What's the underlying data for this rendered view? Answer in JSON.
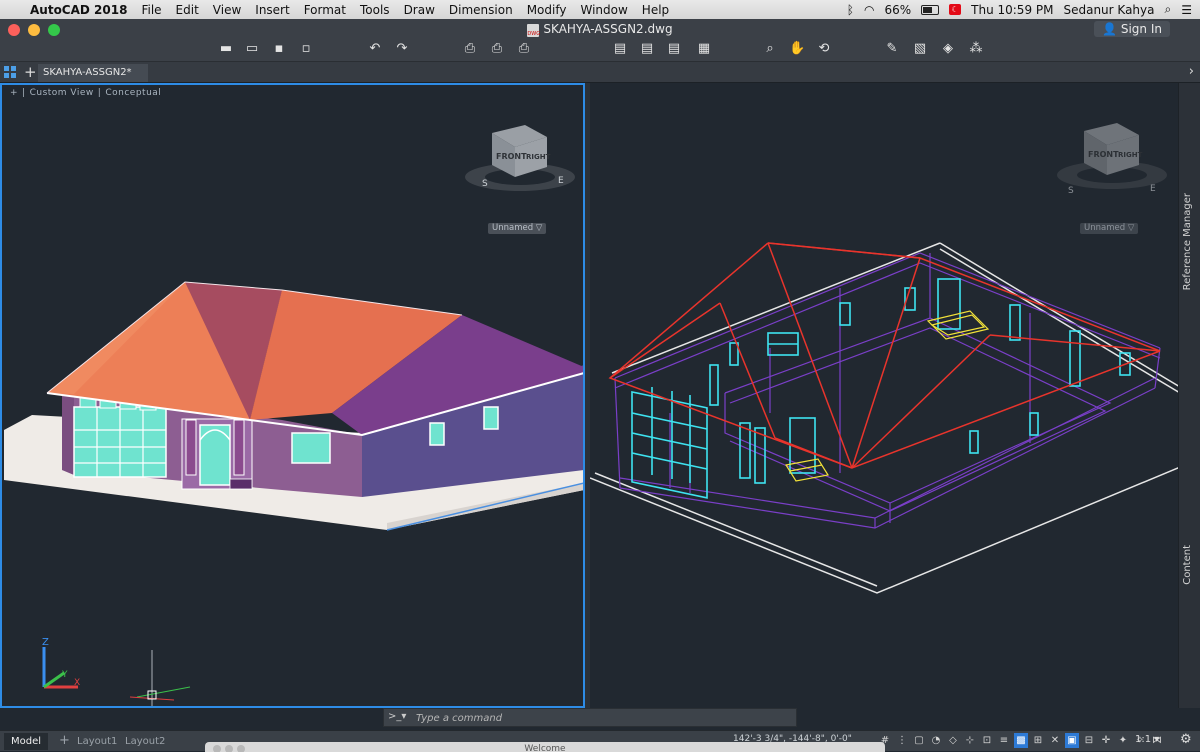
{
  "menubar": {
    "app": "AutoCAD 2018",
    "items": [
      "File",
      "Edit",
      "View",
      "Insert",
      "Format",
      "Tools",
      "Draw",
      "Dimension",
      "Modify",
      "Window",
      "Help"
    ],
    "battery": "66%",
    "clock": "Thu 10:59 PM",
    "user": "Sedanur Kahya"
  },
  "window": {
    "title": "SKAHYA-ASSGN2.dwg",
    "sign_in": "Sign In"
  },
  "tabs": {
    "doc_tab": "SKAHYA-ASSGN2*"
  },
  "viewport_left": {
    "label_plus": "+",
    "view": "Custom View",
    "style": "Conceptual",
    "viewcube_front": "FRONT",
    "viewcube_right": "RIGHT",
    "compass_s": "S",
    "compass_e": "E",
    "ucs": "Unnamed ▽",
    "axis_z": "Z",
    "axis_y": "Y",
    "axis_x": "X"
  },
  "viewport_right": {
    "viewcube_front": "FRONT",
    "viewcube_right": "RIGHT",
    "compass_s": "S",
    "compass_e": "E",
    "ucs": "Unnamed ▽"
  },
  "side_panel": {
    "reference_manager": "Reference Manager",
    "content": "Content"
  },
  "command": {
    "prompt": ">_▾",
    "placeholder": "Type a command"
  },
  "status": {
    "model": "Model",
    "layout1": "Layout1",
    "layout2": "Layout2",
    "coords": "142'-3 3/4\", -144'-8\", 0'-0\"",
    "scale": "1:1 ▾",
    "welcome": "Welcome"
  },
  "colors": {
    "viewport_bg": "#212830",
    "active_border": "#2e8ce6",
    "roof_orange": "#e97a55",
    "wall_purple": "#7c5588",
    "window_cyan": "#5fe5e0",
    "wire_red": "#e8342c",
    "wire_purple": "#7a3fc8",
    "wire_cyan": "#3ee3f0",
    "wire_yellow": "#f2e23a"
  }
}
